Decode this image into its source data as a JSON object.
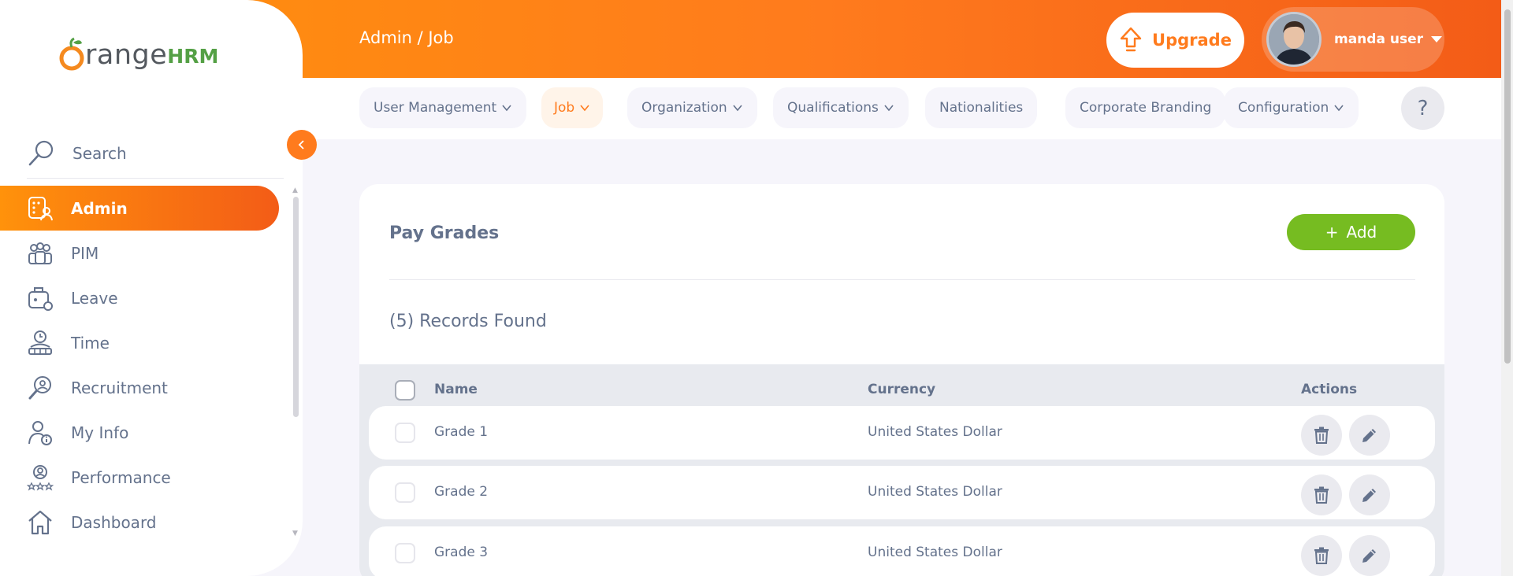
{
  "header": {
    "breadcrumb": "Admin / Job",
    "upgrade_label": "Upgrade",
    "user_name": "manda user"
  },
  "topnav": {
    "items": [
      {
        "label": "User Management",
        "dropdown": true,
        "active": false
      },
      {
        "label": "Job",
        "dropdown": true,
        "active": true
      },
      {
        "label": "Organization",
        "dropdown": true,
        "active": false
      },
      {
        "label": "Qualifications",
        "dropdown": true,
        "active": false
      },
      {
        "label": "Nationalities",
        "dropdown": false,
        "active": false
      },
      {
        "label": "Corporate Branding",
        "dropdown": false,
        "active": false
      },
      {
        "label": "Configuration",
        "dropdown": true,
        "active": false
      }
    ],
    "help_label": "?"
  },
  "sidebar": {
    "logo_text": "range",
    "logo_hrm": "HRM",
    "search_label": "Search",
    "items": [
      {
        "label": "Admin",
        "icon": "admin-icon",
        "active": true
      },
      {
        "label": "PIM",
        "icon": "pim-icon"
      },
      {
        "label": "Leave",
        "icon": "leave-icon"
      },
      {
        "label": "Time",
        "icon": "time-icon"
      },
      {
        "label": "Recruitment",
        "icon": "recruitment-icon"
      },
      {
        "label": "My Info",
        "icon": "my-info-icon"
      },
      {
        "label": "Performance",
        "icon": "performance-icon"
      },
      {
        "label": "Dashboard",
        "icon": "dashboard-icon"
      }
    ]
  },
  "main": {
    "title": "Pay Grades",
    "add_label": "Add",
    "records_found": "(5) Records Found",
    "columns": {
      "name": "Name",
      "currency": "Currency",
      "actions": "Actions"
    },
    "rows": [
      {
        "name": "Grade 1",
        "currency": "United States Dollar"
      },
      {
        "name": "Grade 2",
        "currency": "United States Dollar"
      },
      {
        "name": "Grade 3",
        "currency": "United States Dollar"
      }
    ]
  },
  "colors": {
    "brand_orange": "#ff7b1d",
    "brand_green": "#76bc21",
    "text": "#64728c"
  }
}
